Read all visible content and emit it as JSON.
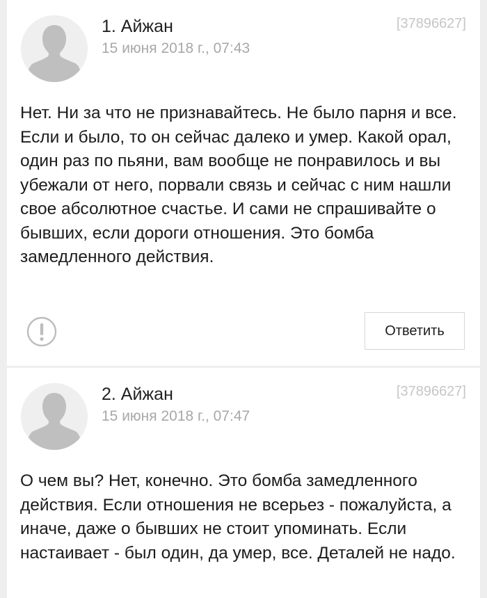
{
  "comments": [
    {
      "author": "1. Айжан",
      "date": "15 июня 2018 г., 07:43",
      "id": "[37896627]",
      "text": "Нет. Ни за что не признавайтесь. Не было парня и все. Если и было, то он сейчас далеко и умер. Какой орал, один раз по пьяни, вам вообще не понравилось и вы убежали от него, порвали связь и сейчас с ним нашли свое абсолютное счастье. И сами не спрашивайте о бывших, если дороги отношения. Это бомба замедленного действия.",
      "reply_label": "Ответить",
      "report_icon": "exclamation-circle-icon"
    },
    {
      "author": "2. Айжан",
      "date": "15 июня 2018 г., 07:47",
      "id": "[37896627]",
      "text": "О чем вы? Нет, конечно. Это бомба замедленного действия. Если отношения не всерьез - пожалуйста, а иначе, даже о бывших не стоит упоминать. Если настаивает - был один, да умер, все. Деталей не надо."
    }
  ],
  "colors": {
    "background": "#eeeeee",
    "card": "#ffffff",
    "text": "#1c1c1c",
    "muted": "#a8a8a8",
    "id": "#c6c6c6",
    "avatar_bg": "#efefef",
    "avatar_silhouette": "#bfbfbf"
  },
  "icons": {
    "avatar": "person-silhouette-icon",
    "report": "exclamation-circle-icon"
  }
}
